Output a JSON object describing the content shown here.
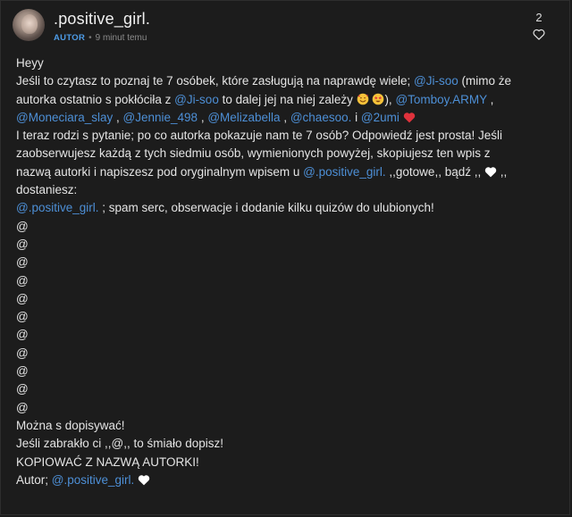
{
  "post": {
    "username": ".positive_girl.",
    "role": "AUTOR",
    "separator": "•",
    "time": "9 minut temu",
    "like_count": "2"
  },
  "content": {
    "l1": "Heyy",
    "l2a": "Jeśli to czytasz to poznaj te 7 osóbek, które zasługują na naprawdę wiele; ",
    "m_jisoo": "@Ji-soo",
    "l2b": " (mimo że",
    "l3a": "autorka ostatnio s pokłóciła z ",
    "l3b": " to dalej jej na niej zależy ",
    "l3c": "), ",
    "m_tomboy": "@Tomboy.ARMY",
    "l3d": " ,",
    "m_moneciara": "@Moneciara_slay",
    "sep": " , ",
    "m_jennie": "@Jennie_498",
    "m_meli": "@Melizabella",
    "m_chaesoo": "@chaesoo.",
    "i": " i ",
    "m_2umi": "@2umi",
    "l5": "I teraz rodzi s pytanie; po co autorka pokazuje nam te 7 osób? Odpowiedź jest prosta! Jeśli",
    "l6": "zaobserwujesz każdą z tych siedmiu osób, wymienionych powyżej, skopiujesz ten wpis z",
    "l7a": "nazwą autorki i napiszesz pod oryginalnym wpisem u ",
    "m_pg": "@.positive_girl.",
    "l7b": " ,,gotowe,, bądź ,, ",
    "l7c": " ,,",
    "l8": "dostaniesz:",
    "l9b": " ; spam serc, obserwacje i dodanie kilku quizów do ulubionych!",
    "at": "@",
    "l21": "Można s dopisywać!",
    "l22": "Jeśli zabrakło ci ,,@,, to śmiało dopisz!",
    "l23": "KOPIOWAĆ Z NAZWĄ AUTORKI!",
    "l24": "Autor; "
  },
  "colors": {
    "background": "#1c1c1c",
    "text": "#e4e4e4",
    "mention": "#4d8fd6",
    "role": "#4d9be6",
    "heart_red": "#e0323c",
    "heart_white": "#ffffff"
  },
  "icons": [
    "avatar",
    "heart-outline-icon",
    "smiling-face-with-hearts-emoji",
    "star-struck-emoji",
    "red-heart-emoji",
    "white-heart-emoji"
  ]
}
